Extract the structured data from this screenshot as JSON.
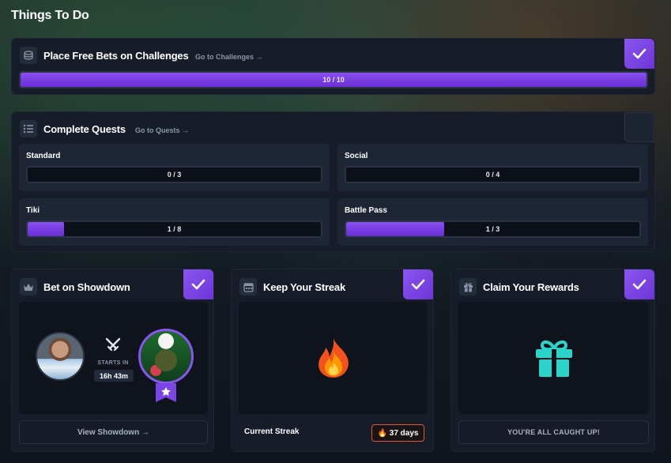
{
  "page": {
    "title": "Things To Do"
  },
  "challenges": {
    "title": "Place Free Bets on Challenges",
    "link": "Go to Challenges →",
    "progress_text": "10 / 10",
    "progress": 1.0,
    "completed": true,
    "icon": "coins-icon"
  },
  "quests": {
    "title": "Complete Quests",
    "link": "Go to Quests →",
    "icon": "list-icon",
    "completed": false,
    "items": [
      {
        "name": "Standard",
        "progress_text": "0 / 3",
        "progress": 0.0
      },
      {
        "name": "Social",
        "progress_text": "0 / 4",
        "progress": 0.0
      },
      {
        "name": "Tiki",
        "progress_text": "1 / 8",
        "progress": 0.125
      },
      {
        "name": "Battle Pass",
        "progress_text": "1 / 3",
        "progress": 0.333
      }
    ]
  },
  "showdown": {
    "title": "Bet on Showdown",
    "icon": "crown-icon",
    "completed": true,
    "starts_label": "STARTS IN",
    "countdown": "16h 43m",
    "button": "View Showdown →"
  },
  "streak": {
    "title": "Keep Your Streak",
    "icon": "calendar-icon",
    "completed": true,
    "footer_label": "Current Streak",
    "streak_value": "🔥 37 days"
  },
  "rewards": {
    "title": "Claim Your Rewards",
    "icon": "gift-icon",
    "completed": true,
    "footer": "YOU'RE ALL CAUGHT UP!"
  },
  "colors": {
    "accent": "#7b45e6",
    "gift": "#2ad4c8",
    "streak_border": "#e0573a"
  }
}
